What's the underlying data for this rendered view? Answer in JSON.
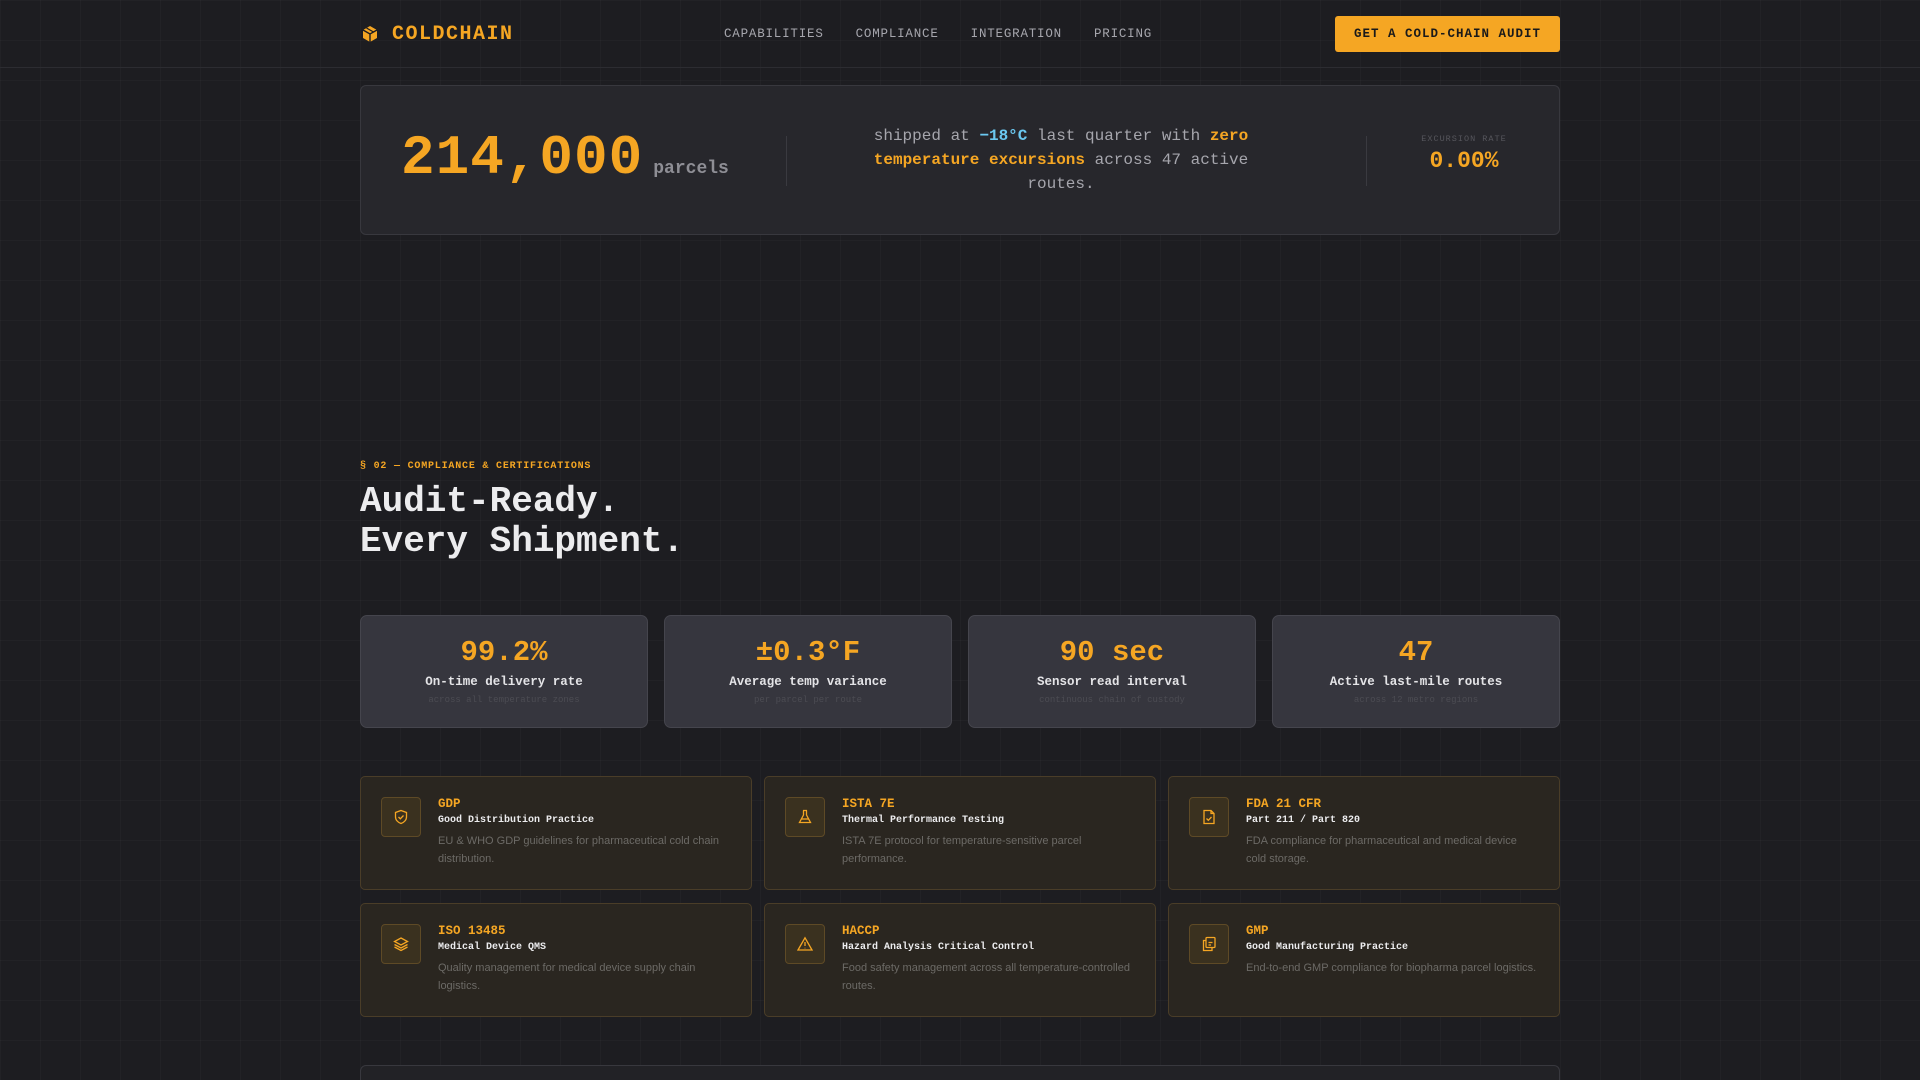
{
  "nav": {
    "brand": "COLDCHAIN",
    "links": [
      "CAPABILITIES",
      "COMPLIANCE",
      "INTEGRATION",
      "PRICING"
    ],
    "cta": "GET A COLD-CHAIN AUDIT"
  },
  "hero": {
    "number": "214,000",
    "unit": "parcels",
    "text_pre": "shipped at ",
    "temp": "−18°C",
    "text_mid": " last quarter with ",
    "highlight": "zero temperature excursions",
    "text_post": " across 47 active routes.",
    "excursion_label": "EXCURSION RATE",
    "excursion_value": "0.00%"
  },
  "compliance": {
    "tag": "§ 02 — COMPLIANCE & CERTIFICATIONS",
    "title_line1": "Audit-Ready.",
    "title_line2": "Every Shipment."
  },
  "metrics": [
    {
      "value": "99.2%",
      "label": "On-time delivery rate",
      "sub": "across all temperature zones"
    },
    {
      "value": "±0.3°F",
      "label": "Average temp variance",
      "sub": "per parcel per route"
    },
    {
      "value": "90 sec",
      "label": "Sensor read interval",
      "sub": "continuous chain of custody"
    },
    {
      "value": "47",
      "label": "Active last-mile routes",
      "sub": "across 12 metro regions"
    }
  ],
  "certs": [
    {
      "code": "GDP",
      "name": "Good Distribution Practice",
      "desc": "EU & WHO GDP guidelines for pharmaceutical cold chain distribution.",
      "icon": "shield-icon"
    },
    {
      "code": "ISTA 7E",
      "name": "Thermal Performance Testing",
      "desc": "ISTA 7E protocol for temperature-sensitive parcel performance.",
      "icon": "flask-icon"
    },
    {
      "code": "FDA 21 CFR",
      "name": "Part 211 / Part 820",
      "desc": "FDA compliance for pharmaceutical and medical device cold storage.",
      "icon": "document-check-icon"
    },
    {
      "code": "ISO 13485",
      "name": "Medical Device QMS",
      "desc": "Quality management for medical device supply chain logistics.",
      "icon": "layers-icon"
    },
    {
      "code": "HACCP",
      "name": "Hazard Analysis Critical Control",
      "desc": "Food safety management across all temperature-controlled routes.",
      "icon": "warning-icon"
    },
    {
      "code": "GMP",
      "name": "Good Manufacturing Practice",
      "desc": "End-to-end GMP compliance for biopharma parcel logistics.",
      "icon": "clipboard-icon"
    }
  ],
  "colors": {
    "accent": "#f5a623",
    "cold": "#6bc8f0",
    "background": "#1d1d21"
  }
}
